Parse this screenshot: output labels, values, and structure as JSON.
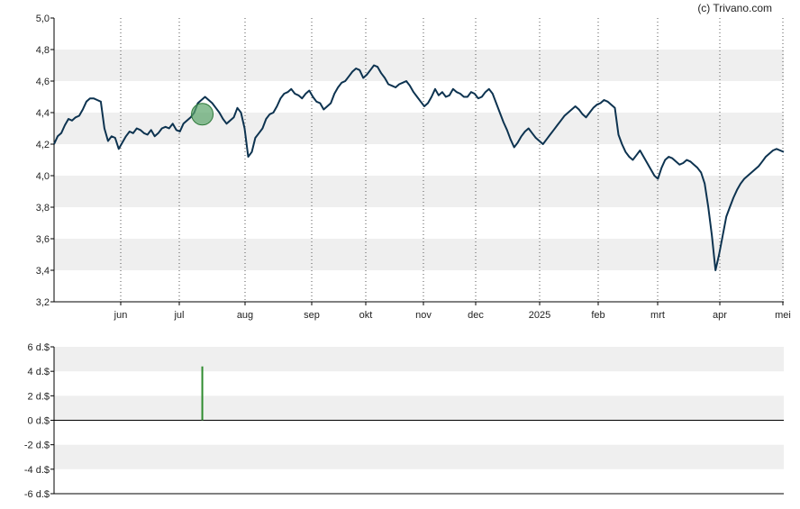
{
  "credit": "(c) Trivano.com",
  "colors": {
    "line": "#0d3350",
    "band": "#efefef",
    "grid": "#555555",
    "marker_fill": "#5aa469",
    "marker_stroke": "#2f7a3b",
    "dividend_bar": "#2e8b2e"
  },
  "chart_data": [
    {
      "type": "line",
      "title": "",
      "ylim": [
        3.2,
        5.0
      ],
      "y_ticks": [
        "5,0",
        "4,8",
        "4,6",
        "4,4",
        "4,2",
        "4,0",
        "3,8",
        "3,6",
        "3,4",
        "3,2"
      ],
      "x_ticks": [
        "jun",
        "jul",
        "aug",
        "sep",
        "okt",
        "nov",
        "dec",
        "2025",
        "feb",
        "mrt",
        "apr",
        "mei"
      ],
      "grid": "vertical dotted at month ticks, alternating horizontal bands",
      "series": [
        {
          "values": [
            4.2,
            4.25,
            4.27,
            4.32,
            4.36,
            4.35,
            4.37,
            4.38,
            4.42,
            4.47,
            4.49,
            4.49,
            4.48,
            4.47,
            4.3,
            4.22,
            4.25,
            4.24,
            4.17,
            4.21,
            4.25,
            4.28,
            4.27,
            4.3,
            4.29,
            4.27,
            4.26,
            4.29,
            4.25,
            4.27,
            4.3,
            4.31,
            4.3,
            4.33,
            4.29,
            4.28,
            4.33,
            4.35,
            4.37,
            4.4,
            4.46,
            4.48,
            4.5,
            4.48,
            4.46,
            4.43,
            4.4,
            4.36,
            4.33,
            4.35,
            4.37,
            4.43,
            4.4,
            4.3,
            4.12,
            4.15,
            4.24,
            4.27,
            4.3,
            4.36,
            4.39,
            4.4,
            4.44,
            4.49,
            4.52,
            4.53,
            4.55,
            4.52,
            4.51,
            4.49,
            4.52,
            4.54,
            4.5,
            4.47,
            4.46,
            4.42,
            4.44,
            4.46,
            4.52,
            4.56,
            4.59,
            4.6,
            4.63,
            4.66,
            4.68,
            4.67,
            4.62,
            4.64,
            4.67,
            4.7,
            4.69,
            4.65,
            4.62,
            4.58,
            4.57,
            4.56,
            4.58,
            4.59,
            4.6,
            4.57,
            4.53,
            4.5,
            4.47,
            4.44,
            4.46,
            4.5,
            4.55,
            4.51,
            4.53,
            4.5,
            4.51,
            4.55,
            4.53,
            4.52,
            4.5,
            4.5,
            4.53,
            4.52,
            4.49,
            4.5,
            4.53,
            4.55,
            4.52,
            4.46,
            4.4,
            4.34,
            4.29,
            4.23,
            4.18,
            4.21,
            4.25,
            4.28,
            4.3,
            4.27,
            4.24,
            4.22,
            4.2,
            4.23,
            4.26,
            4.29,
            4.32,
            4.35,
            4.38,
            4.4,
            4.42,
            4.44,
            4.42,
            4.39,
            4.37,
            4.4,
            4.43,
            4.45,
            4.46,
            4.48,
            4.47,
            4.45,
            4.43,
            4.26,
            4.2,
            4.15,
            4.12,
            4.1,
            4.13,
            4.16,
            4.12,
            4.08,
            4.04,
            4.0,
            3.98,
            4.05,
            4.1,
            4.12,
            4.11,
            4.09,
            4.07,
            4.08,
            4.1,
            4.09,
            4.07,
            4.05,
            4.02,
            3.95,
            3.8,
            3.62,
            3.4,
            3.5,
            3.62,
            3.74,
            3.8,
            3.86,
            3.91,
            3.95,
            3.98,
            4.0,
            4.02,
            4.04,
            4.06,
            4.09,
            4.12,
            4.14,
            4.16,
            4.17,
            4.16,
            4.15
          ]
        }
      ]
    },
    {
      "type": "bar",
      "title": "",
      "ylim": [
        -6,
        6
      ],
      "y_ticks": [
        "6 d.$",
        "4 d.$",
        "2 d.$",
        "0 d.$",
        "-2 d.$",
        "-4 d.$",
        "-6 d.$"
      ],
      "events": [
        {
          "month_position": 1.35,
          "value": 4.4
        }
      ]
    }
  ],
  "marker": {
    "month_position": 1.35,
    "value": 4.39
  }
}
